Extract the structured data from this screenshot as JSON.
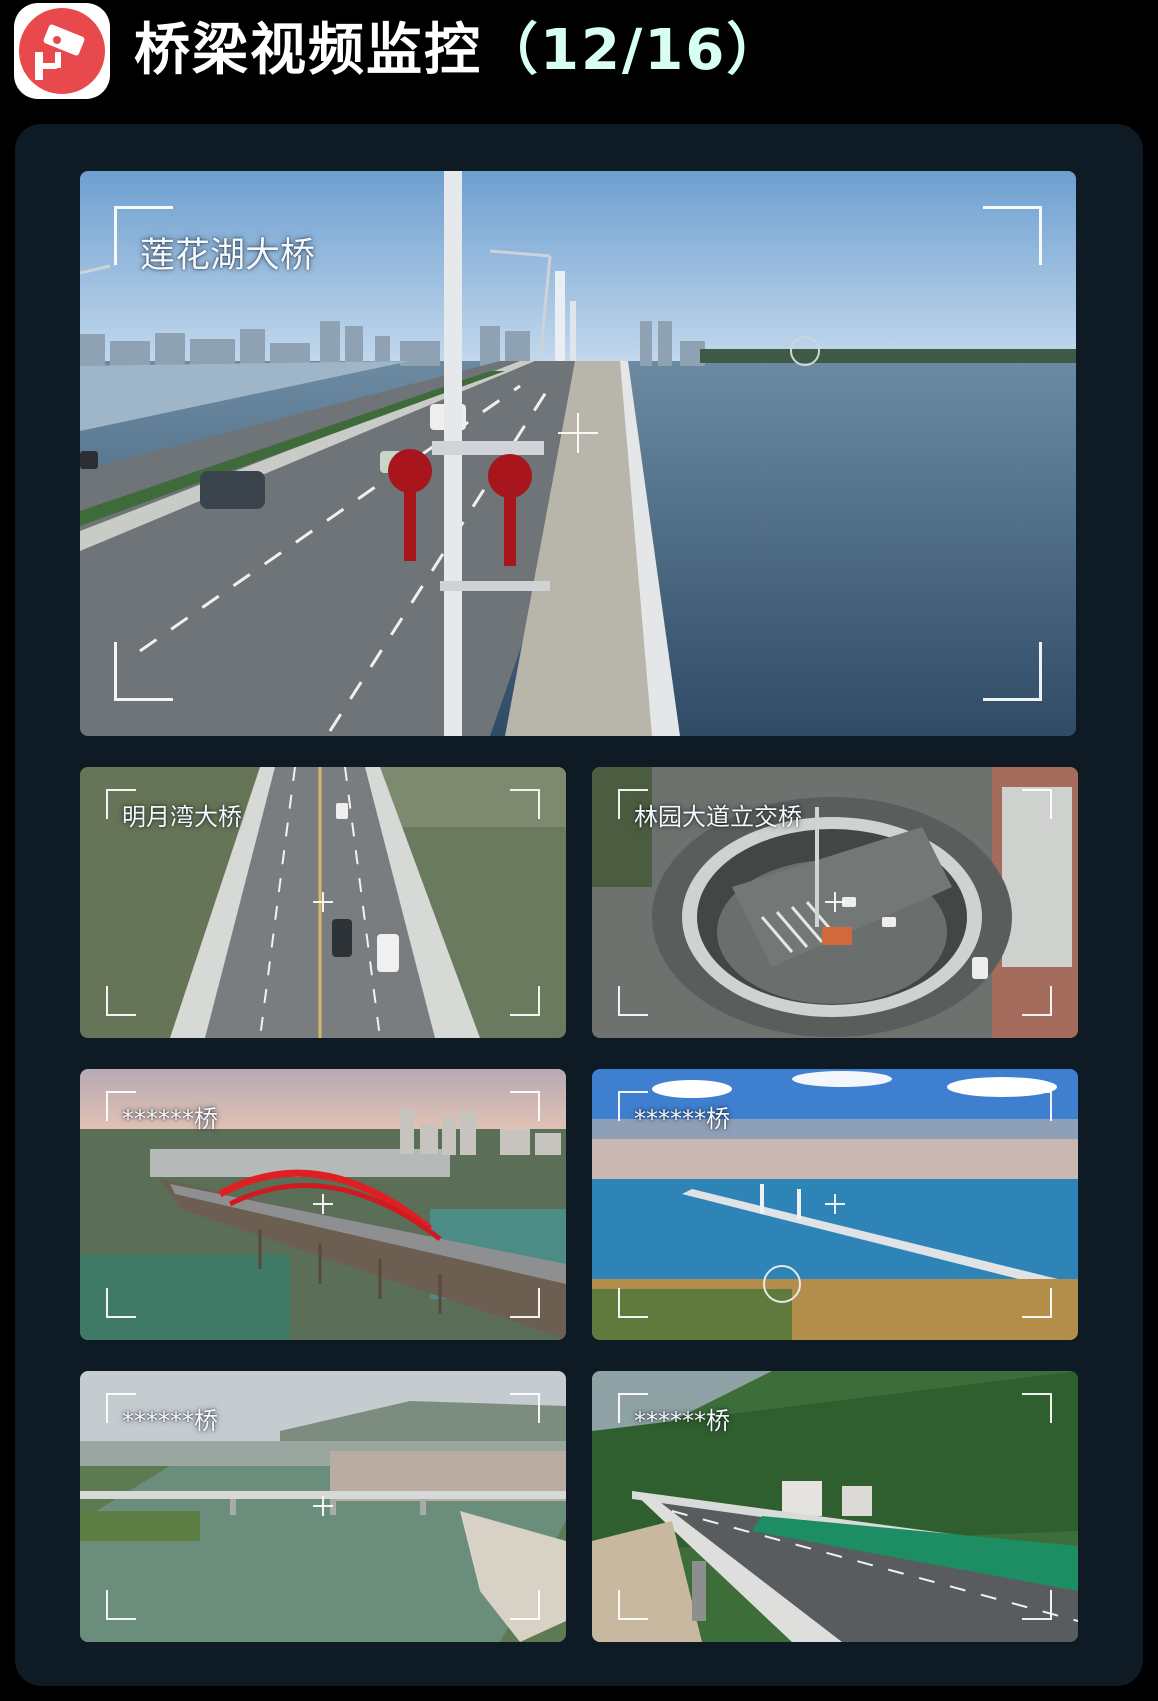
{
  "header": {
    "title": "桥梁视频监控",
    "count": "（12/16）",
    "logo_icon": "surveillance-camera-icon",
    "accent_color": "#e8494c"
  },
  "cameras": [
    {
      "label": "莲花湖大桥",
      "scene": "cable-stayed bridge over lake, road with cars"
    },
    {
      "label": "明月湾大桥",
      "scene": "aerial top-down bridge over green river"
    },
    {
      "label": "林园大道立交桥",
      "scene": "aerial roundabout interchange"
    },
    {
      "label": "******桥",
      "scene": "red arch bridge over river with city"
    },
    {
      "label": "******桥",
      "scene": "cable-stayed bridge over lake, blue sky, ferris wheel"
    },
    {
      "label": "******桥",
      "scene": "long flat bridge over river with village"
    },
    {
      "label": "******桥",
      "scene": "highway bridge through green hills"
    }
  ]
}
